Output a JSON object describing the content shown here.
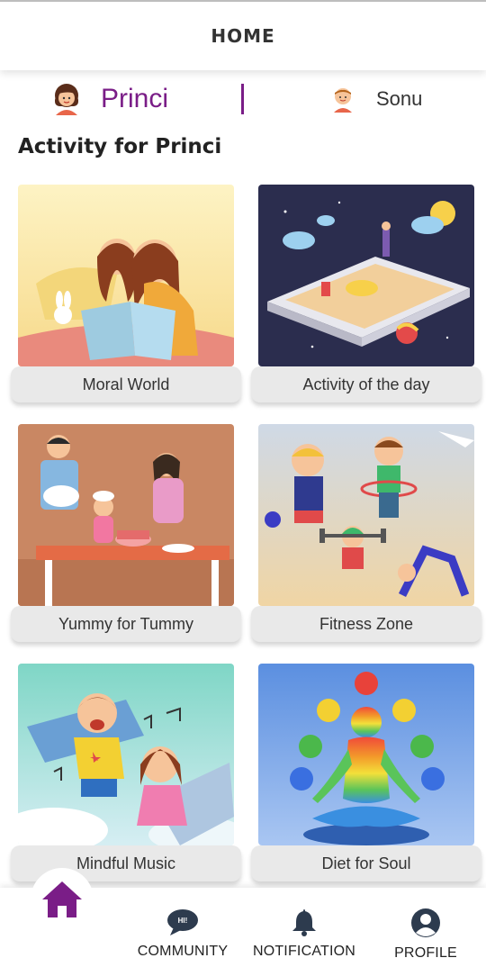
{
  "header": {
    "title": "HOME"
  },
  "kids": [
    {
      "name": "Princi",
      "active": true,
      "avatar": "girl-avatar-icon"
    },
    {
      "name": "Sonu",
      "active": false,
      "avatar": "boy-avatar-icon"
    }
  ],
  "section": {
    "title": "Activity for Princi"
  },
  "activities": [
    {
      "label": "Moral World"
    },
    {
      "label": "Activity of the day"
    },
    {
      "label": "Yummy for Tummy"
    },
    {
      "label": "Fitness Zone"
    },
    {
      "label": "Mindful Music"
    },
    {
      "label": "Diet for Soul"
    }
  ],
  "nav": {
    "home_icon": "home-icon",
    "items": [
      {
        "label": "COMMUNITY",
        "icon": "chat-bubble-icon"
      },
      {
        "label": "NOTIFICATION",
        "icon": "bell-icon"
      },
      {
        "label": "PROFILE",
        "icon": "profile-icon"
      }
    ]
  },
  "colors": {
    "accent": "#7a1d87",
    "label_bg": "#e9e9e9",
    "text": "#333333"
  }
}
